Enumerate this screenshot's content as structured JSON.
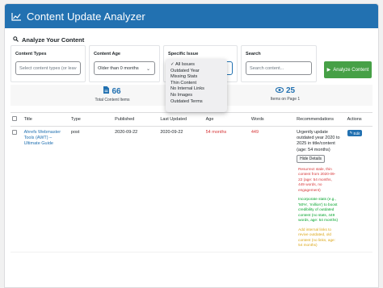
{
  "app": {
    "title": "Content Update Analyzer"
  },
  "section": {
    "title": "Analyze Your Content"
  },
  "filters": {
    "content_types": {
      "label": "Content Types",
      "placeholder": "Select content types (or leave b"
    },
    "content_age": {
      "label": "Content Age",
      "value": "Older than 0 months"
    },
    "specific_issue": {
      "label": "Specific Issue",
      "options": [
        {
          "label": "All Issues",
          "selected": true
        },
        {
          "label": "Outdated Year",
          "selected": false
        },
        {
          "label": "Missing Stats",
          "selected": false
        },
        {
          "label": "Thin Content",
          "selected": false
        },
        {
          "label": "No Internal Links",
          "selected": false
        },
        {
          "label": "No Images",
          "selected": false
        },
        {
          "label": "Outdated Terms",
          "selected": false
        }
      ]
    },
    "search": {
      "label": "Search",
      "placeholder": "Search content..."
    },
    "analyze_label": "Analyze Content"
  },
  "stats": {
    "total": {
      "value": "66",
      "label": "Total Content Items"
    },
    "page": {
      "value": "25",
      "label": "Items on Page 1"
    }
  },
  "table": {
    "headers": [
      "Title",
      "Type",
      "Published",
      "Last Updated",
      "Age",
      "Words",
      "Recommendations",
      "Actions"
    ],
    "rows": [
      {
        "title": "Ahrefs Webmaster Tools (AWT) – Ultimate Guide",
        "type": "post",
        "published": "2020-09-22",
        "updated": "2020-09-22",
        "age": "54 months",
        "words": "449",
        "recommendation": "Urgently update outdated year 2020 to 2025 in title/content (age: 54 months)",
        "hide_label": "Hide Details",
        "details": [
          "Resurrect stale, thin content from 2020-09-22 (age: 54 months, 449 words, no engagement)",
          "Incorporate stats (e.g., '50%', 'million') to boost credibility of outdated content (no stats, 449 words, age: 54 months)",
          "Add internal links to revive outdated, old content (no links, age: 54 months)"
        ],
        "edit_label": "Edit"
      }
    ]
  },
  "colors": {
    "header": "#2271b1",
    "accent": "#2271b1",
    "analyze_button": "#46a046",
    "age_warning": "#d63638",
    "detail_red": "#d63638",
    "detail_green": "#00a32a",
    "detail_orange": "#dba617"
  },
  "icons": {
    "header": "chart-line-icon",
    "section": "search-icon",
    "analyze": "play-icon",
    "total": "document-icon",
    "page": "eye-icon",
    "edit": "edit-icon"
  }
}
